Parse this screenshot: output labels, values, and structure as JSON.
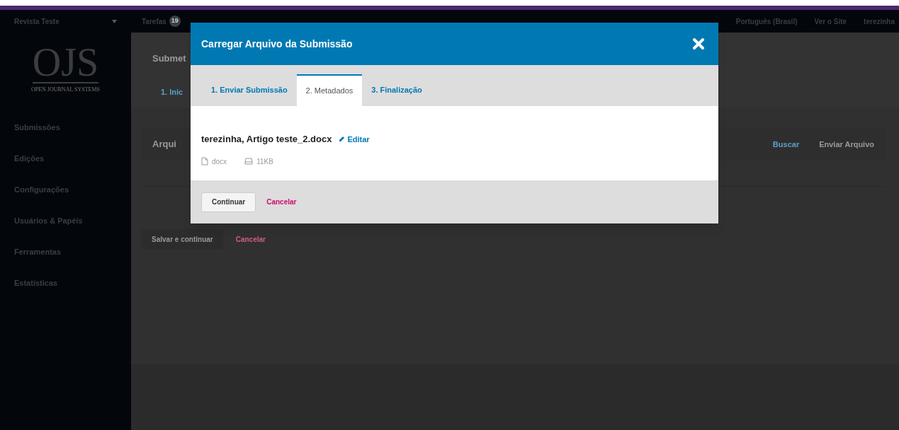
{
  "top_bar": {
    "journal": "Revista Teste",
    "tasks_label": "Tarefas",
    "tasks_count": "19",
    "language": "Português (Brasil)",
    "view_site": "Ver o Site",
    "user": "terezinha"
  },
  "logo": {
    "title": "OJS",
    "subtitle": "OPEN JOURNAL SYSTEMS"
  },
  "sidebar": {
    "items": [
      {
        "label": "Submissões",
        "selected": false
      },
      {
        "label": "Edições",
        "selected": false
      },
      {
        "label": "Configurações",
        "selected": false
      },
      {
        "label": "Usuários & Papéis",
        "selected": false
      },
      {
        "label": "Ferramentas",
        "selected": false
      },
      {
        "label": "Estatísticas",
        "selected": false
      }
    ]
  },
  "page": {
    "title": "Submet",
    "tabs": [
      {
        "label": "1. Inic",
        "selected": true
      }
    ],
    "grid_title": "Arqui",
    "grid_actions": [
      "Buscar",
      "Enviar Arquivo"
    ],
    "save_button": "Salvar e continuar",
    "cancel_link": "Cancelar"
  },
  "modal": {
    "title": "Carregar Arquivo da Submissão",
    "tabs": [
      {
        "label": "1. Enviar Submissão",
        "selected": false
      },
      {
        "label": "2. Metadados",
        "selected": true
      },
      {
        "label": "3. Finalização",
        "selected": false
      }
    ],
    "file_name": "terezinha, Artigo teste_2.docx",
    "edit_link": "Editar",
    "file_type": "docx",
    "file_size": "11KB",
    "continue_button": "Continuar",
    "cancel_link": "Cancelar"
  }
}
